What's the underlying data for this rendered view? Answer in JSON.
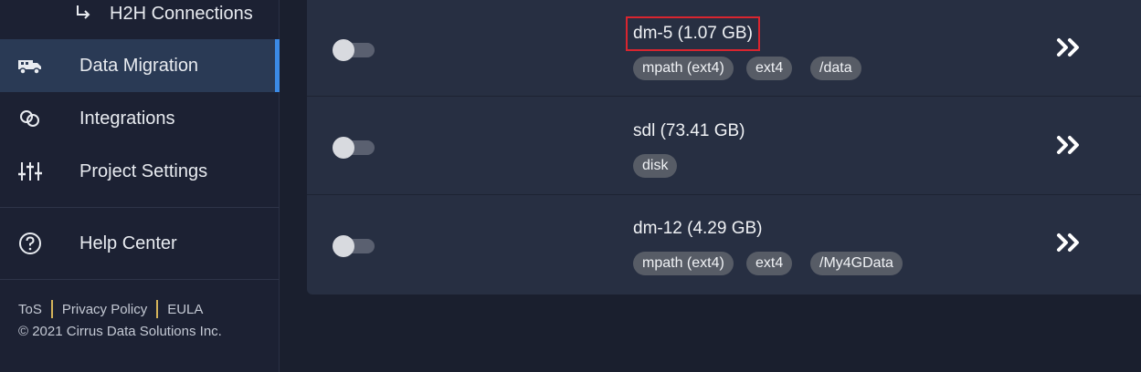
{
  "sidebar": {
    "sub_item": {
      "label": "H2H Connections",
      "icon": "return-arrow-icon"
    },
    "items": [
      {
        "label": "Data Migration",
        "icon": "truck-migration-icon",
        "active": true
      },
      {
        "label": "Integrations",
        "icon": "link-rings-icon",
        "active": false
      },
      {
        "label": "Project Settings",
        "icon": "sliders-icon",
        "active": false
      },
      {
        "label": "Help Center",
        "icon": "question-circle-icon",
        "active": false
      }
    ],
    "footer": {
      "links": [
        "ToS",
        "Privacy Policy",
        "EULA"
      ],
      "copyright": "© 2021 Cirrus Data Solutions Inc."
    }
  },
  "volumes": [
    {
      "title": "dm-5 (1.07 GB)",
      "tags": [
        "mpath (ext4)",
        "ext4",
        "/data"
      ],
      "selected": false,
      "highlighted": true
    },
    {
      "title": "sdl (73.41 GB)",
      "tags": [
        "disk"
      ],
      "selected": false,
      "highlighted": false
    },
    {
      "title": "dm-12 (4.29 GB)",
      "tags": [
        "mpath (ext4)",
        "ext4",
        "/My4GData"
      ],
      "selected": false,
      "highlighted": false
    }
  ],
  "colors": {
    "accent": "#3b8ae6",
    "highlight_box": "#d9252f",
    "chip_bg": "#575c66",
    "footer_separator": "#d4b35a"
  }
}
